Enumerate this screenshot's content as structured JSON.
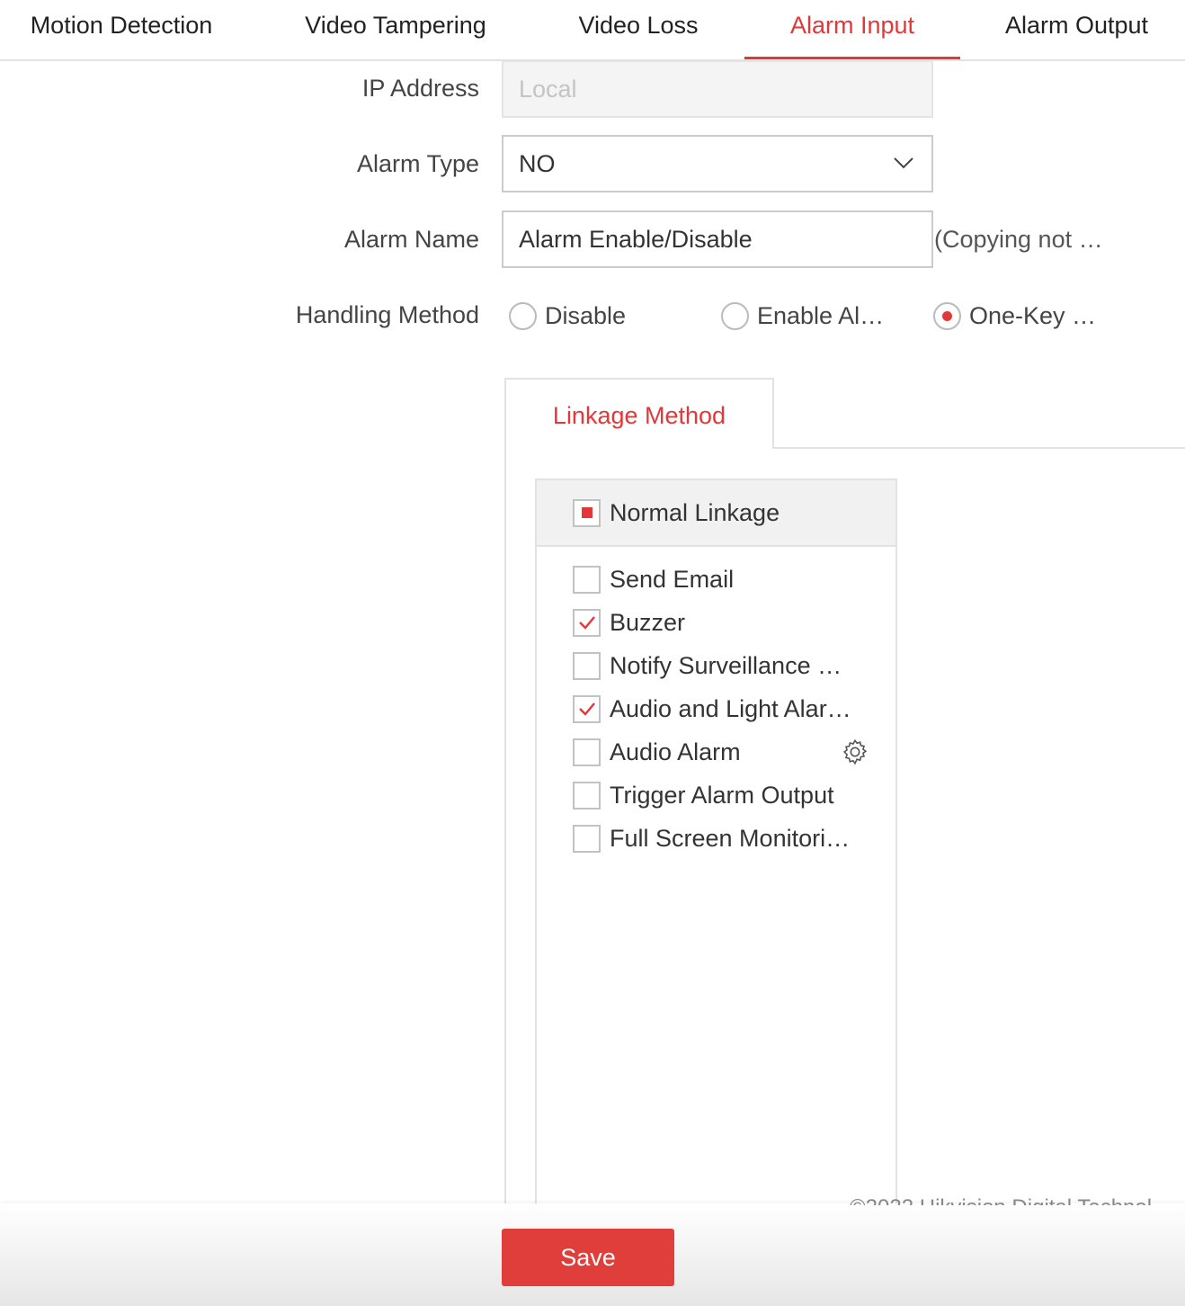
{
  "tabs": [
    {
      "label": "Motion Detection"
    },
    {
      "label": "Video Tampering"
    },
    {
      "label": "Video Loss"
    },
    {
      "label": "Alarm Input",
      "active": true
    },
    {
      "label": "Alarm Output"
    }
  ],
  "form": {
    "ip_label": "IP Address",
    "ip_value": "Local",
    "type_label": "Alarm Type",
    "type_value": "NO",
    "name_label": "Alarm Name",
    "name_value": "Alarm Enable/Disable",
    "name_hint": "(Copying not …",
    "handling_label": "Handling Method",
    "handling_options": [
      {
        "label": "Disable",
        "selected": false
      },
      {
        "label": "Enable Al…",
        "selected": false
      },
      {
        "label": "One-Key …",
        "selected": true
      }
    ]
  },
  "linkage": {
    "tab_label": "Linkage Method",
    "group_label": "Normal Linkage",
    "group_state": "partial",
    "items": [
      {
        "label": "Send Email",
        "checked": false
      },
      {
        "label": "Buzzer",
        "checked": true
      },
      {
        "label": "Notify Surveillance …",
        "checked": false
      },
      {
        "label": "Audio and Light Alar…",
        "checked": true
      },
      {
        "label": "Audio Alarm",
        "checked": false,
        "icon": "gear-icon"
      },
      {
        "label": "Trigger Alarm Output",
        "checked": false
      },
      {
        "label": "Full Screen Monitori…",
        "checked": false
      }
    ]
  },
  "footer": {
    "copyright": "©2022 Hikvision Digital Technol",
    "save_label": "Save"
  },
  "colors": {
    "accent": "#e2383a"
  }
}
